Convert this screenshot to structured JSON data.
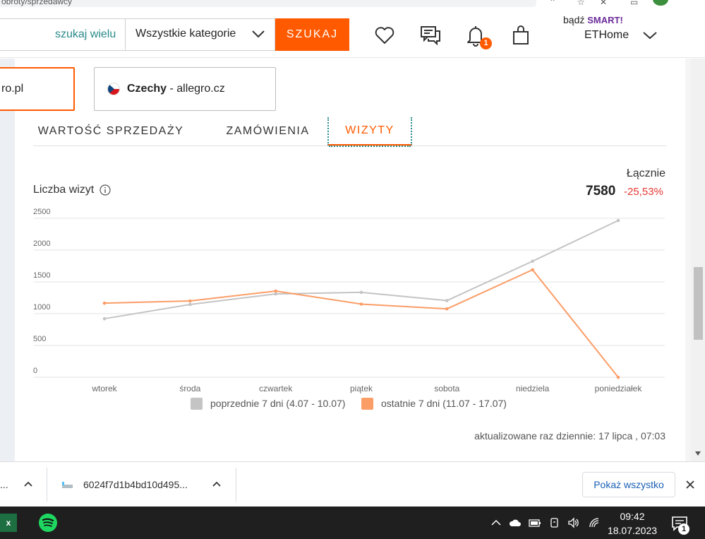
{
  "browser": {
    "url_fragment": "obroty/sprzedawcy"
  },
  "header": {
    "search_many_label": "szukaj wielu",
    "category_value": "Wszystkie kategorie",
    "search_button_label": "SZUKAJ",
    "notifications_count": "1",
    "smart_prefix": "bądź",
    "smart_brand": "SMART!",
    "username": "ETHome"
  },
  "markets": [
    {
      "label": "ro.pl",
      "active": true
    },
    {
      "country": "Czechy",
      "domain": " - allegro.cz",
      "active": false
    }
  ],
  "tabs": [
    {
      "label": "WARTOŚĆ SPRZEDAŻY",
      "active": false
    },
    {
      "label": "ZAMÓWIENIA",
      "active": false
    },
    {
      "label": "WIZYTY",
      "active": true
    }
  ],
  "metric": {
    "title": "Liczba wizyt",
    "total_label": "Łącznie",
    "total_value": "7580",
    "total_change": "-25,53%"
  },
  "chart_data": {
    "type": "line",
    "categories": [
      "wtorek",
      "środa",
      "czwartek",
      "piątek",
      "sobota",
      "niedziela",
      "poniedziałek"
    ],
    "series": [
      {
        "name": "poprzednie 7 dni (4.07 - 10.07)",
        "color": "#c4c4c4",
        "values": [
          920,
          1145,
          1310,
          1335,
          1205,
          1825,
          2465
        ]
      },
      {
        "name": "ostatnie 7 dni (11.07 - 17.07)",
        "color": "#fb9d67",
        "values": [
          1165,
          1200,
          1355,
          1150,
          1075,
          1690,
          0
        ]
      }
    ],
    "yticks": [
      "2500",
      "2000",
      "1500",
      "1000",
      "500",
      "0"
    ],
    "ylim": [
      0,
      2500
    ],
    "grid": true,
    "legend": "bottom"
  },
  "updated_text": "aktualizowane raz dziennie: 17 lipca , 07:03",
  "downloads": {
    "item1": "...",
    "item2": "6024f7d1b4bd10d495...",
    "show_all": "Pokaż wszystko"
  },
  "taskbar": {
    "time": "09:42",
    "date": "18.07.2023",
    "notification_count": "1",
    "excel_letter": "x"
  }
}
